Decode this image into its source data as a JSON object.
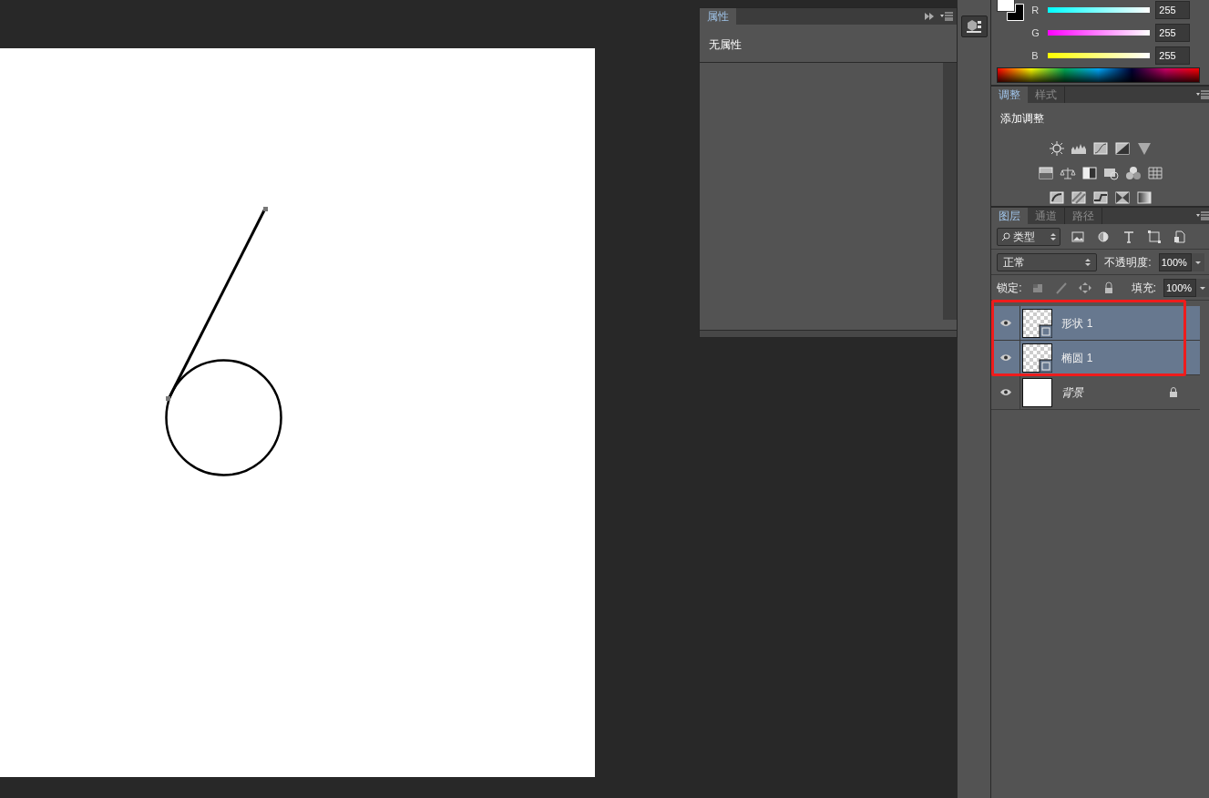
{
  "properties_panel": {
    "tabs": [
      {
        "label": "属性",
        "selected": true
      }
    ],
    "text": "无属性"
  },
  "color_panel": {
    "channels": [
      {
        "name": "R",
        "value": "255",
        "level": 1
      },
      {
        "name": "G",
        "value": "255",
        "level": 1
      },
      {
        "name": "B",
        "value": "255",
        "level": 1
      }
    ]
  },
  "adjustments_panel": {
    "tabs": [
      {
        "label": "调整",
        "selected": true
      },
      {
        "label": "样式",
        "selected": false
      }
    ],
    "title": "添加调整"
  },
  "layers_panel": {
    "tabs": [
      {
        "label": "图层",
        "selected": true
      },
      {
        "label": "通道",
        "selected": false
      },
      {
        "label": "路径",
        "selected": false
      }
    ],
    "filter": "类型",
    "blend_mode": "正常",
    "opacity_label": "不透明度:",
    "opacity": "100%",
    "lock_label": "锁定:",
    "fill_label": "填充:",
    "fill": "100%",
    "layers": [
      {
        "name": "形状 1",
        "kind": "shape",
        "selected": true,
        "visible": true,
        "locked": false
      },
      {
        "name": "椭圆 1",
        "kind": "shape",
        "selected": true,
        "visible": true,
        "locked": false
      },
      {
        "name": "背景",
        "kind": "background",
        "selected": false,
        "visible": true,
        "locked": true
      }
    ]
  }
}
